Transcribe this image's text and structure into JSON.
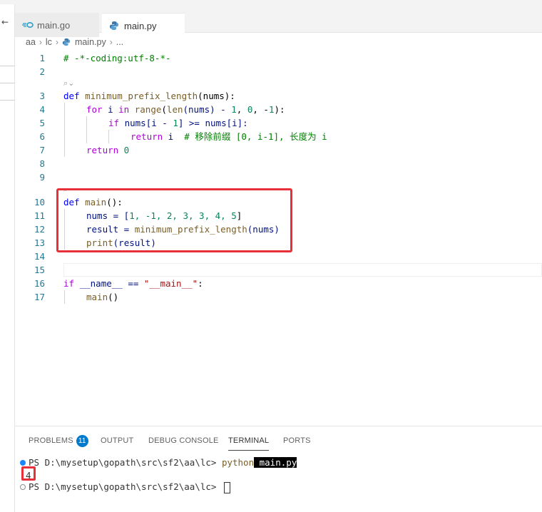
{
  "tabs": [
    {
      "label": "main.go",
      "active": false,
      "icon": "go-file-icon"
    },
    {
      "label": "main.py",
      "active": true,
      "icon": "python-file-icon"
    }
  ],
  "breadcrumb": {
    "parts": [
      "aa",
      "lc",
      "main.py",
      "..."
    ]
  },
  "editor": {
    "line_numbers": [
      "1",
      "2",
      "3",
      "4",
      "5",
      "6",
      "7",
      "8",
      "9",
      "10",
      "11",
      "12",
      "13",
      "14",
      "15",
      "16",
      "17"
    ],
    "code": {
      "l1": "# -*-coding:utf-8-*-",
      "l3_def": "def",
      "l3_fn": "minimum_prefix_length",
      "l3_rest": "(nums):",
      "l4_for": "for",
      "l4_i": " i ",
      "l4_in": "in",
      "l4_range": "range",
      "l4_p1": "(",
      "l4_len": "len",
      "l4_p2": "(nums) - ",
      "l4_n1": "1",
      "l4_c1": ", ",
      "l4_n2": "0",
      "l4_c2": ", -",
      "l4_n3": "1",
      "l4_p3": "):",
      "l5_if": "if",
      "l5_a": " nums[i - ",
      "l5_n": "1",
      "l5_b": "] >= nums[i]:",
      "l6_ret": "return",
      "l6_i": " i  ",
      "l6_cmt": "# 移除前缀 [0, i-1], 长度为 i",
      "l7_ret": "return",
      "l7_n": " 0",
      "l10_def": "def",
      "l10_fn": "main",
      "l10_rest": "():",
      "l11_a": "nums = [",
      "l11_vals": "1, -1, 2, 3, 3, 4, 5",
      "l11_b": "]",
      "l12_a": "result = ",
      "l12_fn": "minimum_prefix_length",
      "l12_b": "(nums)",
      "l13_fn": "print",
      "l13_b": "(result)",
      "l16_if": "if",
      "l16_a": " __name__ == ",
      "l16_str": "\"__main__\"",
      "l16_b": ":",
      "l17_fn": "main",
      "l17_b": "()"
    },
    "codelens_1": "⌕⌄",
    "codelens_2": "⌕"
  },
  "panel": {
    "tabs": [
      "PROBLEMS",
      "OUTPUT",
      "DEBUG CONSOLE",
      "TERMINAL",
      "PORTS"
    ],
    "active_tab": "TERMINAL",
    "problems_count": "11"
  },
  "terminal": {
    "line1_prompt": "PS D:\\mysetup\\gopath\\src\\sf2\\aa\\lc> ",
    "line1_cmd": "python",
    "line1_arg": " main.py",
    "line2_output": "4",
    "line3_prompt": "PS D:\\mysetup\\gopath\\src\\sf2\\aa\\lc> "
  },
  "colors": {
    "highlight_box": "#e8303a",
    "badge": "#007acc",
    "keyword": "#0000ff",
    "control": "#af00db",
    "function": "#795e26",
    "number": "#098658",
    "string": "#a31515",
    "comment": "#008000"
  }
}
